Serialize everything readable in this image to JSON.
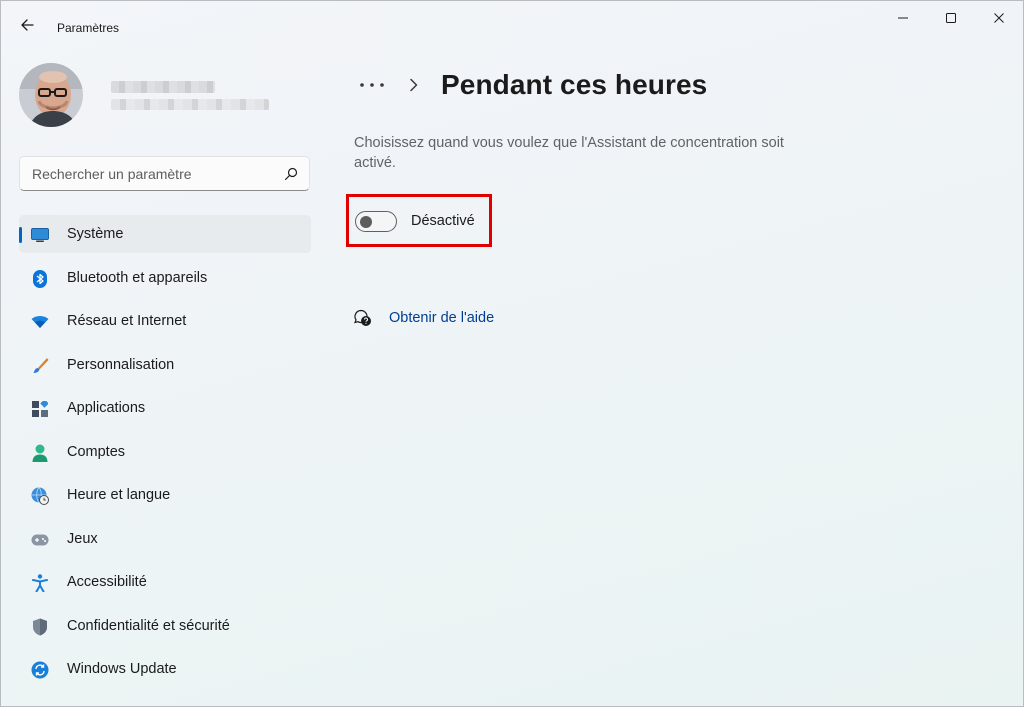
{
  "window": {
    "title": "Paramètres",
    "back_icon": "arrow-left-icon",
    "controls": [
      "minimize-icon",
      "maximize-icon",
      "close-icon"
    ]
  },
  "profile": {
    "avatar_icon": "user-avatar"
  },
  "search": {
    "placeholder": "Rechercher un paramètre",
    "value": "",
    "icon": "search-icon"
  },
  "sidebar": {
    "items": [
      {
        "label": "Système",
        "icon": "monitor-icon",
        "active": true
      },
      {
        "label": "Bluetooth et appareils",
        "icon": "bluetooth-icon",
        "active": false
      },
      {
        "label": "Réseau et Internet",
        "icon": "wifi-icon",
        "active": false
      },
      {
        "label": "Personnalisation",
        "icon": "brush-icon",
        "active": false
      },
      {
        "label": "Applications",
        "icon": "apps-icon",
        "active": false
      },
      {
        "label": "Comptes",
        "icon": "person-icon",
        "active": false
      },
      {
        "label": "Heure et langue",
        "icon": "globe-clock-icon",
        "active": false
      },
      {
        "label": "Jeux",
        "icon": "gamepad-icon",
        "active": false
      },
      {
        "label": "Accessibilité",
        "icon": "accessibility-icon",
        "active": false
      },
      {
        "label": "Confidentialité et sécurité",
        "icon": "shield-icon",
        "active": false
      },
      {
        "label": "Windows Update",
        "icon": "sync-icon",
        "active": false
      }
    ]
  },
  "main": {
    "breadcrumb_more": "···",
    "title": "Pendant ces heures",
    "description": "Choisissez quand vous voulez que l'Assistant de concentration soit activé.",
    "toggle": {
      "label": "Désactivé",
      "on": false
    },
    "help_link": "Obtenir de l'aide"
  },
  "colors": {
    "accent": "#0067c0",
    "link": "#003e92",
    "highlight_box": "#e00000"
  }
}
